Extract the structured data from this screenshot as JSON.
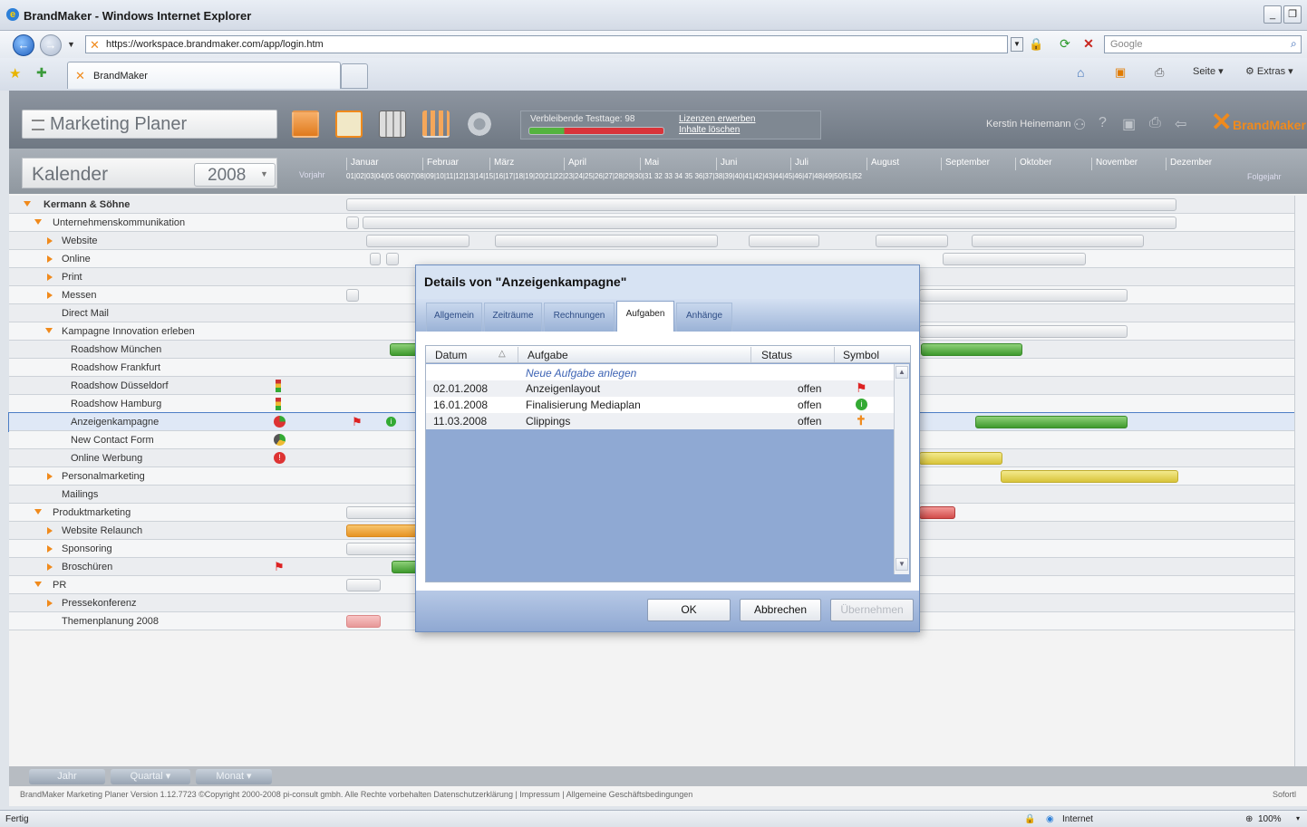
{
  "browser": {
    "window_title": "BrandMaker - Windows Internet Explorer",
    "url": "https://workspace.brandmaker.com/app/login.htm",
    "search_placeholder": "Google",
    "tab_label": "BrandMaker",
    "tools": {
      "page": "Seite",
      "extras": "Extras"
    },
    "status_left": "Fertig",
    "status_zone": "Internet",
    "zoom": "100%"
  },
  "app": {
    "module_title": "Marketing Planer",
    "trial": {
      "text": "Verbleibende Testtage: 98",
      "remaining_fraction": 0.26,
      "link_buy": "Lizenzen erwerben",
      "link_delete": "Inhalte löschen"
    },
    "user": "Kerstin Heinemann",
    "logo": "BrandMaker",
    "calendar_title": "Kalender",
    "year": "2008",
    "prev_year": "Vorjahr",
    "next_year": "Folgejahr",
    "months": [
      "Januar",
      "Februar",
      "März",
      "April",
      "Mai",
      "Juni",
      "Juli",
      "August",
      "September",
      "Oktober",
      "November",
      "Dezember"
    ],
    "weeks": "01|02|03|04|05 06|07|08|09|10|11|12|13|14|15|16|17|18|19|20|21|22|23|24|25|26|27|28|29|30|31 32 33 34 35 36|37|38|39|40|41|42|43|44|45|46|47|48|49|50|51|52",
    "tree": [
      {
        "label": "Kermann & Söhne"
      },
      {
        "label": "Unternehmenskommunikation"
      },
      {
        "label": "Website"
      },
      {
        "label": "Online"
      },
      {
        "label": "Print"
      },
      {
        "label": "Messen"
      },
      {
        "label": "Direct Mail"
      },
      {
        "label": "Kampagne Innovation erleben"
      },
      {
        "label": "Roadshow München"
      },
      {
        "label": "Roadshow Frankfurt"
      },
      {
        "label": "Roadshow Düsseldorf"
      },
      {
        "label": "Roadshow Hamburg"
      },
      {
        "label": "Anzeigenkampagne"
      },
      {
        "label": "New Contact Form"
      },
      {
        "label": "Online Werbung"
      },
      {
        "label": "Personalmarketing"
      },
      {
        "label": "Mailings"
      },
      {
        "label": "Produktmarketing"
      },
      {
        "label": "Website Relaunch"
      },
      {
        "label": "Sponsoring"
      },
      {
        "label": "Broschüren"
      },
      {
        "label": "PR"
      },
      {
        "label": "Pressekonferenz"
      },
      {
        "label": "Themenplanung 2008"
      }
    ],
    "footer_buttons": {
      "year": "Jahr",
      "quarter": "Quartal",
      "month": "Monat"
    },
    "copyright": "BrandMaker Marketing Planer Version 1.12.7723 ©Copyright 2000-2008 pi-consult gmbh. Alle Rechte vorbehalten Datenschutzerklärung | Impressum | Allgemeine Geschäftsbedingungen",
    "sofort": "Sofortl"
  },
  "dialog": {
    "title": "Details von \"Anzeigenkampagne\"",
    "tabs": [
      "Allgemein",
      "Zeiträume",
      "Rechnungen",
      "Aufgaben",
      "Anhänge"
    ],
    "active_tab": "Aufgaben",
    "columns": [
      "Datum",
      "Aufgabe",
      "Status",
      "Symbol"
    ],
    "new_task": "Neue Aufgabe anlegen",
    "rows": [
      {
        "date": "02.01.2008",
        "task": "Anzeigenlayout",
        "status": "offen",
        "symbol": "flag-icon"
      },
      {
        "date": "16.01.2008",
        "task": "Finalisierung Mediaplan",
        "status": "offen",
        "symbol": "info-icon"
      },
      {
        "date": "11.03.2008",
        "task": "Clippings",
        "status": "offen",
        "symbol": "pin-icon"
      }
    ],
    "buttons": {
      "ok": "OK",
      "cancel": "Abbrechen",
      "apply": "Übernehmen"
    }
  }
}
